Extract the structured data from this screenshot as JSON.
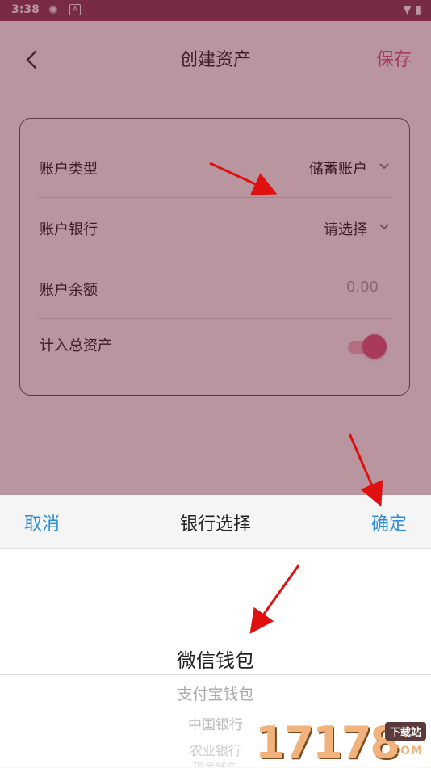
{
  "status_bar": {
    "time": "3:38",
    "icons": [
      "app-icon",
      "a-icon",
      "wifi-icon",
      "battery-charging-icon"
    ]
  },
  "header": {
    "title": "创建资产",
    "save_label": "保存"
  },
  "form": {
    "rows": [
      {
        "label": "账户类型",
        "value": "储蓄账户"
      },
      {
        "label": "账户银行",
        "value": "请选择"
      },
      {
        "label": "账户余额",
        "placeholder": "0.00"
      },
      {
        "label": "计入总资产",
        "toggle_on": true
      }
    ]
  },
  "sheet": {
    "cancel_label": "取消",
    "title": "银行选择",
    "confirm_label": "确定",
    "options": [
      "微信钱包",
      "支付宝钱包",
      "中国银行",
      "农业银行",
      "现金钱包"
    ],
    "selected": "微信钱包"
  },
  "watermark": {
    "number": "17178",
    "tag": "下载站",
    "suffix": ".COM"
  },
  "colors": {
    "accent": "#e05a80",
    "link": "#2f8fd8",
    "status_bar": "#8c3f58",
    "annotation": "#e01010"
  }
}
